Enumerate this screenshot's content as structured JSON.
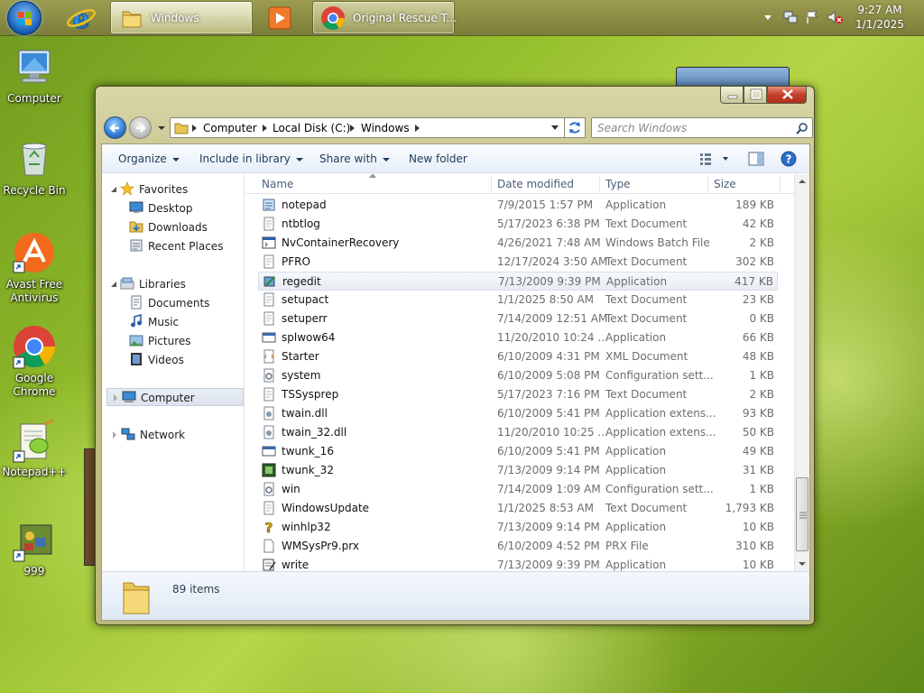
{
  "taskbar": {
    "buttons": [
      {
        "label": "Windows"
      },
      {
        "label": "Original Rescue T..."
      }
    ],
    "clock": {
      "time": "9:27 AM",
      "date": "1/1/2025"
    }
  },
  "desktop": {
    "icons": [
      {
        "label": "Computer"
      },
      {
        "label": "Recycle Bin"
      },
      {
        "label": "Avast Free Antivirus"
      },
      {
        "label": "Google Chrome"
      },
      {
        "label": "Notepad++"
      },
      {
        "label": "999"
      }
    ]
  },
  "explorer": {
    "breadcrumb": [
      "Computer",
      "Local Disk (C:)",
      "Windows"
    ],
    "search_placeholder": "Search Windows",
    "toolbar": {
      "organize": "Organize",
      "include": "Include in library",
      "share": "Share with",
      "new_folder": "New folder"
    },
    "nav": {
      "favorites": "Favorites",
      "desktop": "Desktop",
      "downloads": "Downloads",
      "recent": "Recent Places",
      "libraries": "Libraries",
      "documents": "Documents",
      "music": "Music",
      "pictures": "Pictures",
      "videos": "Videos",
      "computer": "Computer",
      "network": "Network"
    },
    "columns": {
      "name": "Name",
      "date": "Date modified",
      "type": "Type",
      "size": "Size"
    },
    "files": [
      {
        "name": "notepad",
        "date": "7/9/2015 1:57 PM",
        "type": "Application",
        "size": "189 KB"
      },
      {
        "name": "ntbtlog",
        "date": "5/17/2023 6:38 PM",
        "type": "Text Document",
        "size": "42 KB"
      },
      {
        "name": "NvContainerRecovery",
        "date": "4/26/2021 7:48 AM",
        "type": "Windows Batch File",
        "size": "2 KB"
      },
      {
        "name": "PFRO",
        "date": "12/17/2024 3:50 AM",
        "type": "Text Document",
        "size": "302 KB"
      },
      {
        "name": "regedit",
        "date": "7/13/2009 9:39 PM",
        "type": "Application",
        "size": "417 KB"
      },
      {
        "name": "setupact",
        "date": "1/1/2025 8:50 AM",
        "type": "Text Document",
        "size": "23 KB"
      },
      {
        "name": "setuperr",
        "date": "7/14/2009 12:51 AM",
        "type": "Text Document",
        "size": "0 KB"
      },
      {
        "name": "splwow64",
        "date": "11/20/2010 10:24 ...",
        "type": "Application",
        "size": "66 KB"
      },
      {
        "name": "Starter",
        "date": "6/10/2009 4:31 PM",
        "type": "XML Document",
        "size": "48 KB"
      },
      {
        "name": "system",
        "date": "6/10/2009 5:08 PM",
        "type": "Configuration sett...",
        "size": "1 KB"
      },
      {
        "name": "TSSysprep",
        "date": "5/17/2023 7:16 PM",
        "type": "Text Document",
        "size": "2 KB"
      },
      {
        "name": "twain.dll",
        "date": "6/10/2009 5:41 PM",
        "type": "Application extens...",
        "size": "93 KB"
      },
      {
        "name": "twain_32.dll",
        "date": "11/20/2010 10:25 ...",
        "type": "Application extens...",
        "size": "50 KB"
      },
      {
        "name": "twunk_16",
        "date": "6/10/2009 5:41 PM",
        "type": "Application",
        "size": "49 KB"
      },
      {
        "name": "twunk_32",
        "date": "7/13/2009 9:14 PM",
        "type": "Application",
        "size": "31 KB"
      },
      {
        "name": "win",
        "date": "7/14/2009 1:09 AM",
        "type": "Configuration sett...",
        "size": "1 KB"
      },
      {
        "name": "WindowsUpdate",
        "date": "1/1/2025 8:53 AM",
        "type": "Text Document",
        "size": "1,793 KB"
      },
      {
        "name": "winhlp32",
        "date": "7/13/2009 9:14 PM",
        "type": "Application",
        "size": "10 KB"
      },
      {
        "name": "WMSysPr9.prx",
        "date": "6/10/2009 4:52 PM",
        "type": "PRX File",
        "size": "310 KB"
      },
      {
        "name": "write",
        "date": "7/13/2009 9:39 PM",
        "type": "Application",
        "size": "10 KB"
      }
    ],
    "selected_file": "regedit",
    "status": {
      "count": "89 items"
    }
  }
}
